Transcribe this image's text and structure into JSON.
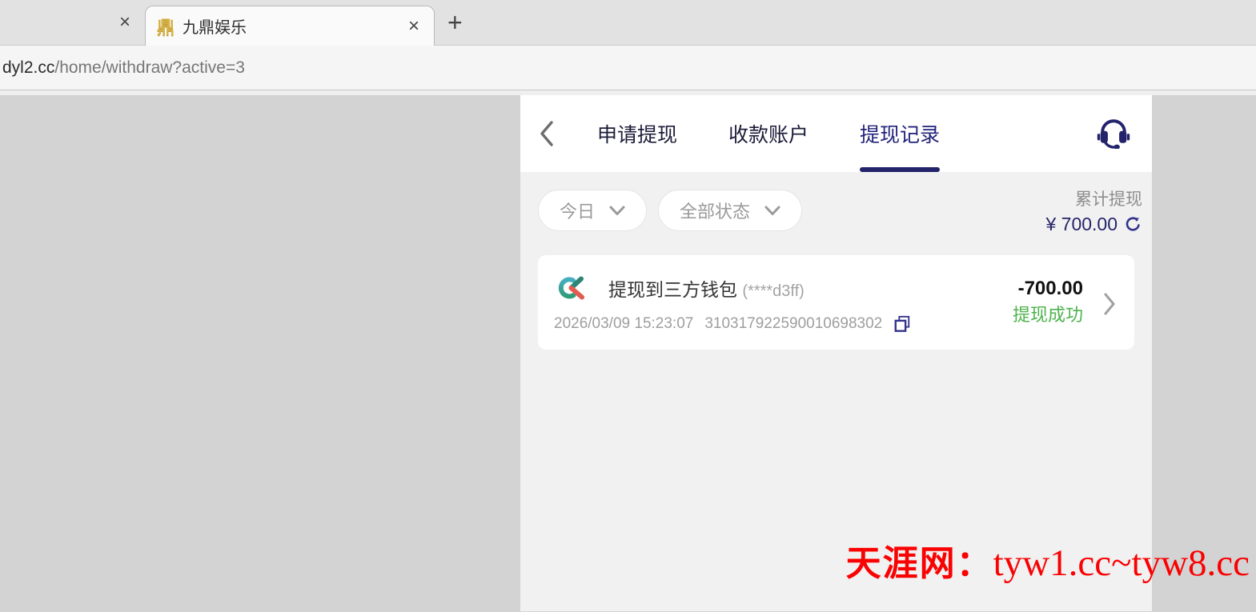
{
  "browser": {
    "tabs": [
      {
        "title": "",
        "close_label": "×"
      },
      {
        "title": "九鼎娱乐",
        "close_label": "×",
        "favicon_glyph": "鼎",
        "favicon_icon": "gold-emblem-icon"
      }
    ],
    "new_tab_label": "+",
    "url": {
      "domain": "dyl2.cc",
      "path": "/home/withdraw?active=3"
    }
  },
  "header": {
    "back_icon": "chevron-left-icon",
    "tabs": [
      {
        "label": "申请提现",
        "active": false
      },
      {
        "label": "收款账户",
        "active": false
      },
      {
        "label": "提现记录",
        "active": true
      }
    ],
    "support_icon": "headset-icon"
  },
  "filters": {
    "date_filter": {
      "value": "今日",
      "icon": "chevron-down-icon"
    },
    "status_filter": {
      "value": "全部状态",
      "icon": "chevron-down-icon"
    }
  },
  "summary": {
    "label": "累计提现",
    "amount": "¥ 700.00",
    "refresh_icon": "refresh-icon"
  },
  "records": [
    {
      "logo": "ck-logo-icon",
      "title": "提现到三方钱包",
      "account_masked": "(****d3ff)",
      "datetime": "2026/03/09 15:23:07",
      "order_no": "310317922590010698302",
      "copy_icon": "copy-icon",
      "amount": "-700.00",
      "status": "提现成功",
      "chevron": "chevron-right-icon"
    }
  ],
  "watermark": {
    "prefix": "天涯网：",
    "text": "tyw1.cc~tyw8.cc"
  },
  "colors": {
    "accent_navy": "#23236b",
    "status_success_green": "#4db34d",
    "watermark_red": "#fa0102",
    "panel_bg": "#f1f1f1",
    "side_bg": "#d3d3d3"
  }
}
